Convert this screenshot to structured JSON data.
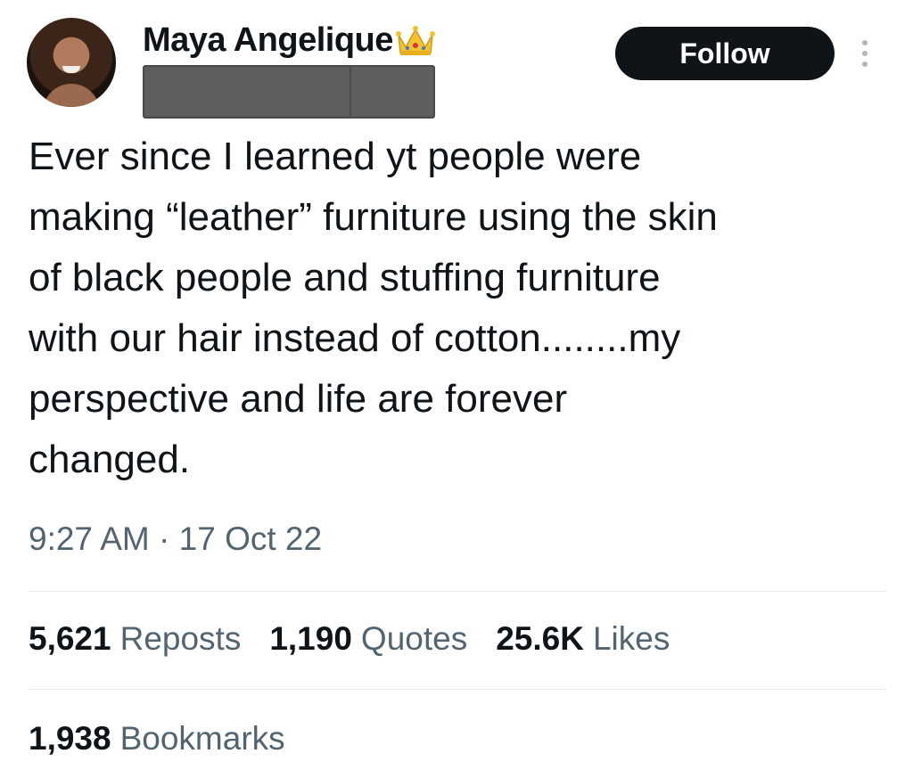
{
  "author": {
    "display_name": "Maya Angelique",
    "badge_icon": "crown-icon",
    "avatar_icon": "avatar-photo",
    "handle_redacted": true
  },
  "follow_label": "Follow",
  "more_icon": "more-vertical-icon",
  "tweet": {
    "text": "Ever since I learned yt people were\nmaking “leather” furniture using the skin\nof black people and stuffing furniture\nwith our hair instead of cotton........my\nperspective and life are forever\nchanged.",
    "time": "9:27 AM",
    "separator": "·",
    "date": "17 Oct 22"
  },
  "stats": {
    "reposts": {
      "value": "5,621",
      "label": "Reposts"
    },
    "quotes": {
      "value": "1,190",
      "label": "Quotes"
    },
    "likes": {
      "value": "25.6K",
      "label": "Likes"
    },
    "bookmarks": {
      "value": "1,938",
      "label": "Bookmarks"
    }
  },
  "colors": {
    "text": "#0f1419",
    "secondary": "#536471",
    "button_bg": "#0f1419",
    "divider": "#e6e9ec"
  }
}
